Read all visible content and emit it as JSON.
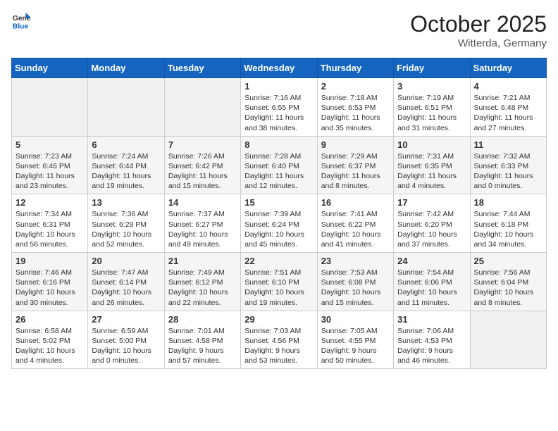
{
  "header": {
    "logo_general": "General",
    "logo_blue": "Blue",
    "month": "October 2025",
    "location": "Witterda, Germany"
  },
  "weekdays": [
    "Sunday",
    "Monday",
    "Tuesday",
    "Wednesday",
    "Thursday",
    "Friday",
    "Saturday"
  ],
  "weeks": [
    [
      {
        "day": "",
        "info": ""
      },
      {
        "day": "",
        "info": ""
      },
      {
        "day": "",
        "info": ""
      },
      {
        "day": "1",
        "info": "Sunrise: 7:16 AM\nSunset: 6:55 PM\nDaylight: 11 hours\nand 38 minutes."
      },
      {
        "day": "2",
        "info": "Sunrise: 7:18 AM\nSunset: 6:53 PM\nDaylight: 11 hours\nand 35 minutes."
      },
      {
        "day": "3",
        "info": "Sunrise: 7:19 AM\nSunset: 6:51 PM\nDaylight: 11 hours\nand 31 minutes."
      },
      {
        "day": "4",
        "info": "Sunrise: 7:21 AM\nSunset: 6:48 PM\nDaylight: 11 hours\nand 27 minutes."
      }
    ],
    [
      {
        "day": "5",
        "info": "Sunrise: 7:23 AM\nSunset: 6:46 PM\nDaylight: 11 hours\nand 23 minutes."
      },
      {
        "day": "6",
        "info": "Sunrise: 7:24 AM\nSunset: 6:44 PM\nDaylight: 11 hours\nand 19 minutes."
      },
      {
        "day": "7",
        "info": "Sunrise: 7:26 AM\nSunset: 6:42 PM\nDaylight: 11 hours\nand 15 minutes."
      },
      {
        "day": "8",
        "info": "Sunrise: 7:28 AM\nSunset: 6:40 PM\nDaylight: 11 hours\nand 12 minutes."
      },
      {
        "day": "9",
        "info": "Sunrise: 7:29 AM\nSunset: 6:37 PM\nDaylight: 11 hours\nand 8 minutes."
      },
      {
        "day": "10",
        "info": "Sunrise: 7:31 AM\nSunset: 6:35 PM\nDaylight: 11 hours\nand 4 minutes."
      },
      {
        "day": "11",
        "info": "Sunrise: 7:32 AM\nSunset: 6:33 PM\nDaylight: 11 hours\nand 0 minutes."
      }
    ],
    [
      {
        "day": "12",
        "info": "Sunrise: 7:34 AM\nSunset: 6:31 PM\nDaylight: 10 hours\nand 56 minutes."
      },
      {
        "day": "13",
        "info": "Sunrise: 7:36 AM\nSunset: 6:29 PM\nDaylight: 10 hours\nand 52 minutes."
      },
      {
        "day": "14",
        "info": "Sunrise: 7:37 AM\nSunset: 6:27 PM\nDaylight: 10 hours\nand 49 minutes."
      },
      {
        "day": "15",
        "info": "Sunrise: 7:39 AM\nSunset: 6:24 PM\nDaylight: 10 hours\nand 45 minutes."
      },
      {
        "day": "16",
        "info": "Sunrise: 7:41 AM\nSunset: 6:22 PM\nDaylight: 10 hours\nand 41 minutes."
      },
      {
        "day": "17",
        "info": "Sunrise: 7:42 AM\nSunset: 6:20 PM\nDaylight: 10 hours\nand 37 minutes."
      },
      {
        "day": "18",
        "info": "Sunrise: 7:44 AM\nSunset: 6:18 PM\nDaylight: 10 hours\nand 34 minutes."
      }
    ],
    [
      {
        "day": "19",
        "info": "Sunrise: 7:46 AM\nSunset: 6:16 PM\nDaylight: 10 hours\nand 30 minutes."
      },
      {
        "day": "20",
        "info": "Sunrise: 7:47 AM\nSunset: 6:14 PM\nDaylight: 10 hours\nand 26 minutes."
      },
      {
        "day": "21",
        "info": "Sunrise: 7:49 AM\nSunset: 6:12 PM\nDaylight: 10 hours\nand 22 minutes."
      },
      {
        "day": "22",
        "info": "Sunrise: 7:51 AM\nSunset: 6:10 PM\nDaylight: 10 hours\nand 19 minutes."
      },
      {
        "day": "23",
        "info": "Sunrise: 7:53 AM\nSunset: 6:08 PM\nDaylight: 10 hours\nand 15 minutes."
      },
      {
        "day": "24",
        "info": "Sunrise: 7:54 AM\nSunset: 6:06 PM\nDaylight: 10 hours\nand 11 minutes."
      },
      {
        "day": "25",
        "info": "Sunrise: 7:56 AM\nSunset: 6:04 PM\nDaylight: 10 hours\nand 8 minutes."
      }
    ],
    [
      {
        "day": "26",
        "info": "Sunrise: 6:58 AM\nSunset: 5:02 PM\nDaylight: 10 hours\nand 4 minutes."
      },
      {
        "day": "27",
        "info": "Sunrise: 6:59 AM\nSunset: 5:00 PM\nDaylight: 10 hours\nand 0 minutes."
      },
      {
        "day": "28",
        "info": "Sunrise: 7:01 AM\nSunset: 4:58 PM\nDaylight: 9 hours\nand 57 minutes."
      },
      {
        "day": "29",
        "info": "Sunrise: 7:03 AM\nSunset: 4:56 PM\nDaylight: 9 hours\nand 53 minutes."
      },
      {
        "day": "30",
        "info": "Sunrise: 7:05 AM\nSunset: 4:55 PM\nDaylight: 9 hours\nand 50 minutes."
      },
      {
        "day": "31",
        "info": "Sunrise: 7:06 AM\nSunset: 4:53 PM\nDaylight: 9 hours\nand 46 minutes."
      },
      {
        "day": "",
        "info": ""
      }
    ]
  ]
}
